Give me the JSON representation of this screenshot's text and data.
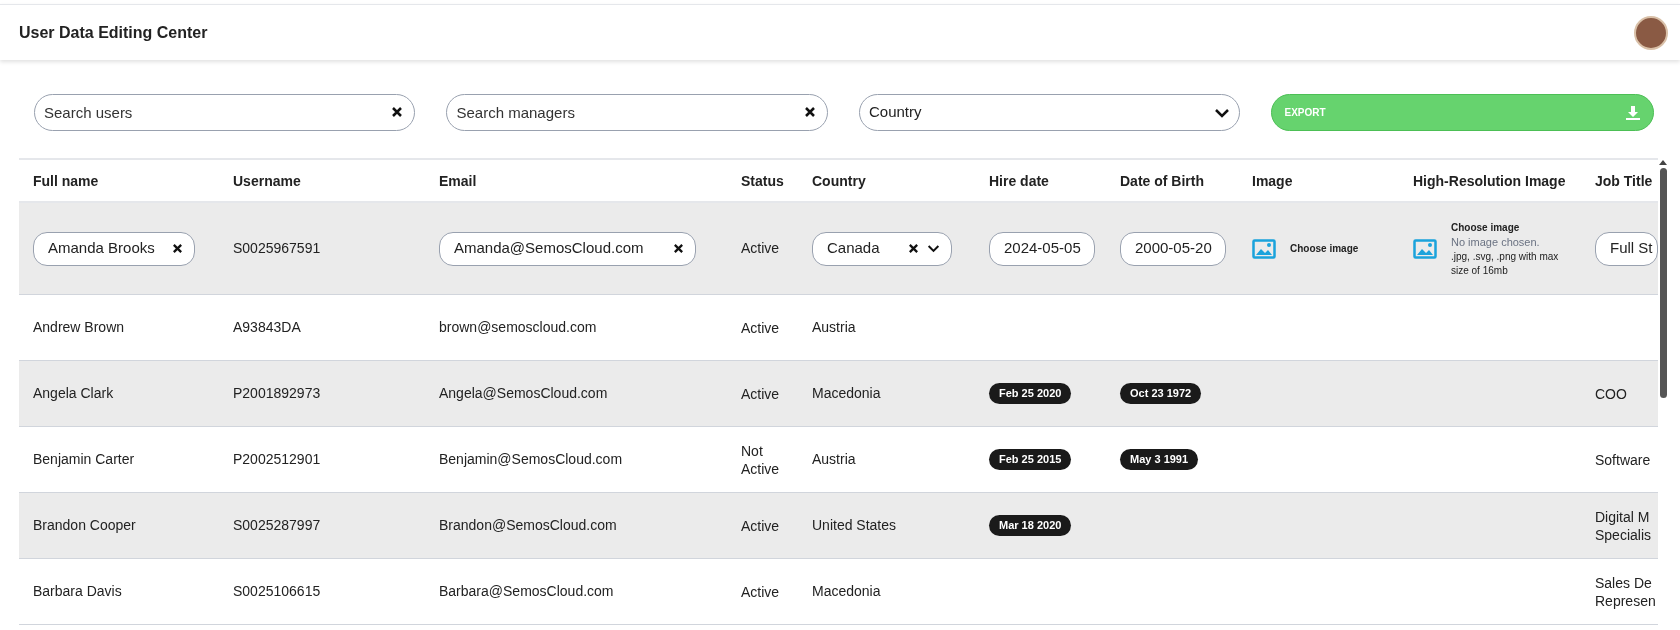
{
  "header": {
    "title": "User Data Editing Center"
  },
  "filters": {
    "search_users": {
      "placeholder": "Search users"
    },
    "search_managers": {
      "placeholder": "Search managers"
    },
    "country": {
      "placeholder": "Country"
    },
    "export_button": "EXPORT"
  },
  "table": {
    "columns": [
      "Full name",
      "Username",
      "Email",
      "Status",
      "Country",
      "Hire date",
      "Date of Birth",
      "Image",
      "High-Resolution Image",
      "Job Title"
    ],
    "edit_row": {
      "full_name": "Amanda Brooks",
      "username": "S0025967591",
      "email": "Amanda@SemosCloud.com",
      "status": "Active",
      "country": "Canada",
      "hire_date": "2024-05-05",
      "date_of_birth": "2000-05-20",
      "image": {
        "button": "Choose image"
      },
      "high_resolution_image": {
        "button": "Choose image",
        "file_status": "No image chosen.",
        "hint": ".jpg, .svg, .png with max size of 16mb"
      },
      "job_title": "Full St"
    },
    "rows": [
      {
        "full_name": "Andrew Brown",
        "username": "A93843DA",
        "email": "brown@semoscloud.com",
        "status": "Active",
        "country": "Austria"
      },
      {
        "full_name": "Angela Clark",
        "username": "P2001892973",
        "email": "Angela@SemosCloud.com",
        "status": "Active",
        "country": "Macedonia",
        "hire_date": "Feb 25 2020",
        "date_of_birth": "Oct 23 1972",
        "job_title": "COO"
      },
      {
        "full_name": "Benjamin Carter",
        "username": "P2002512901",
        "email": "Benjamin@SemosCloud.com",
        "status": "Not Active",
        "country": "Austria",
        "hire_date": "Feb 25 2015",
        "date_of_birth": "May 3 1991",
        "job_title": "Software"
      },
      {
        "full_name": "Brandon Cooper",
        "username": "S0025287997",
        "email": "Brandon@SemosCloud.com",
        "status": "Active",
        "country": "United States",
        "hire_date": "Mar 18 2020",
        "job_title": "Digital M Specialis"
      },
      {
        "full_name": "Barbara Davis",
        "username": "S0025106615",
        "email": "Barbara@SemosCloud.com",
        "status": "Active",
        "country": "Macedonia",
        "job_title": "Sales De Represen"
      }
    ]
  }
}
